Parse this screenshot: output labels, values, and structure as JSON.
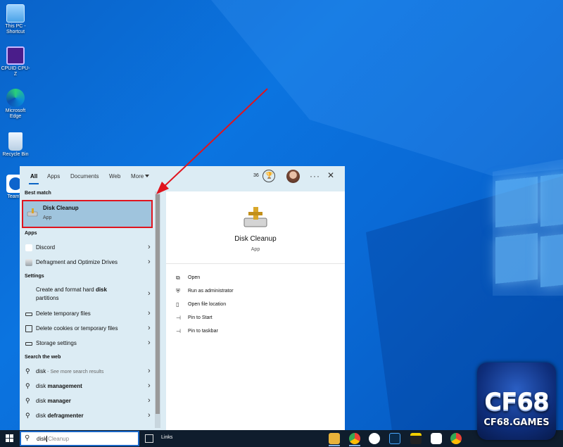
{
  "desktop": {
    "icons": [
      {
        "label_line1": "This PC -",
        "label_line2": "Shortcut",
        "icon": "this-pc-icon"
      },
      {
        "label_line1": "CPUID CPU-Z",
        "label_line2": "",
        "icon": "cpuz-icon"
      },
      {
        "label_line1": "Microsoft",
        "label_line2": "Edge",
        "icon": "edge-icon"
      },
      {
        "label_line1": "Recycle Bin",
        "label_line2": "",
        "icon": "recycle-bin-icon"
      },
      {
        "label_line1": "TeamVi",
        "label_line2": "",
        "icon": "teamviewer-icon"
      }
    ]
  },
  "search_panel": {
    "tabs": [
      {
        "label": "All",
        "active": true
      },
      {
        "label": "Apps"
      },
      {
        "label": "Documents"
      },
      {
        "label": "Web"
      },
      {
        "label": "More"
      }
    ],
    "points": "36",
    "best_match": {
      "heading": "Best match",
      "title": "Disk Cleanup",
      "subtitle": "App"
    },
    "apps": {
      "heading": "Apps",
      "items": [
        {
          "label": "Discord",
          "icon": "discord-icon"
        },
        {
          "label": "Defragment and Optimize Drives",
          "icon": "defrag-icon"
        }
      ]
    },
    "settings": {
      "heading": "Settings",
      "items": [
        {
          "label_pre": "Create and format hard ",
          "label_bold": "disk",
          "label_line2": "partitions"
        },
        {
          "label": "Delete temporary files"
        },
        {
          "label": "Delete cookies or temporary files"
        },
        {
          "label": "Storage settings"
        }
      ]
    },
    "web": {
      "heading": "Search the web",
      "items": [
        {
          "typed": "disk",
          "suffix": "",
          "hint": " - See more search results"
        },
        {
          "typed": "disk",
          "suffix": " management",
          "hint": ""
        },
        {
          "typed": "disk",
          "suffix": " manager",
          "hint": ""
        },
        {
          "typed": "disk",
          "suffix": " defragmenter",
          "hint": ""
        }
      ]
    },
    "preview": {
      "title": "Disk Cleanup",
      "subtitle": "App",
      "actions": [
        {
          "label": "Open",
          "icon": "open-icon"
        },
        {
          "label": "Run as administrator",
          "icon": "admin-shield-icon"
        },
        {
          "label": "Open file location",
          "icon": "file-location-icon"
        },
        {
          "label": "Pin to Start",
          "icon": "pin-icon"
        },
        {
          "label": "Pin to taskbar",
          "icon": "pin-icon"
        }
      ]
    }
  },
  "taskbar": {
    "search_typed": "disk",
    "search_ghost": "Cleanup",
    "links_label": "Links"
  },
  "watermark": {
    "brand": "CF68",
    "domain": "CF68.GAMES"
  },
  "colors": {
    "accent": "#0a64c5",
    "highlight_border": "#e0141e",
    "best_match_bg": "#9fc4dd",
    "taskbar": "#0f1d2d"
  }
}
